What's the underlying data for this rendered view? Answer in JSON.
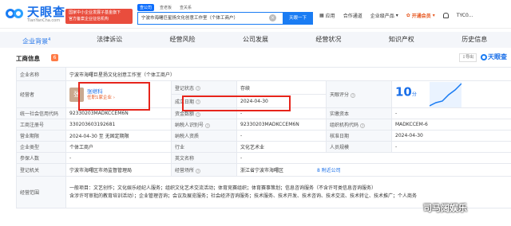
{
  "header": {
    "logo_text": "天眼查",
    "logo_url": "TianYanCha.com",
    "promo_line1": "国家中小企业发展子基金旗下",
    "promo_line2": "官方备案企业征信机构",
    "search_tabs": [
      "查公司",
      "查老板",
      "查关系"
    ],
    "search_value": "宁波市海曙巨星扬文化创意工作室（个体工商户）",
    "search_button": "天眼一下",
    "nav": {
      "app": "应用",
      "partner": "合作通道",
      "enterprise": "企业级产品",
      "vip": "开通会员",
      "user": "TYC0..."
    }
  },
  "tabs": [
    {
      "label": "企业背景",
      "sup": "4",
      "active": true
    },
    {
      "label": "法律诉讼",
      "sup": "",
      "active": false
    },
    {
      "label": "经营风险",
      "sup": "",
      "active": false
    },
    {
      "label": "公司发展",
      "sup": "",
      "active": false
    },
    {
      "label": "经营状况",
      "sup": "",
      "active": false
    },
    {
      "label": "知识产权",
      "sup": "",
      "active": false
    },
    {
      "label": "历史信息",
      "sup": "",
      "active": false
    }
  ],
  "section": {
    "title": "工商信息",
    "badge": "6",
    "export": "导出",
    "brand": "天眼查"
  },
  "company": {
    "name_label": "企业名称",
    "name": "宁波市海曙巨星扬文化创意工作室（个体工商户）",
    "operator_label": "经营者",
    "operator_avatar": "张",
    "operator_name": "张继科",
    "operator_sub": "任职1家企业 ›",
    "reg_status_label": "登记状态",
    "reg_status": "存续",
    "est_date_label": "成立日期",
    "est_date": "2024-04-30",
    "score_label": "天眼评分",
    "score": "10",
    "score_unit": "分",
    "credit_code_label": "统一社会信用代码",
    "credit_code": "92330203MADKCCEM6N",
    "capital_label": "资金数额",
    "capital": "-",
    "paid_capital_label": "实缴资本",
    "paid_capital": "-",
    "reg_no_label": "工商注册号",
    "reg_no": "330203603192681",
    "tax_id_label": "纳税人识别号",
    "tax_id": "92330203MADKCCEM6N",
    "org_code_label": "组织机构代码",
    "org_code": "MADKCCEM-6",
    "term_label": "营业期限",
    "term": "2024-04-30 至 无固定期限",
    "taxpayer_label": "纳税人资质",
    "taxpayer": "-",
    "approve_label": "核准日期",
    "approve": "2024-04-30",
    "type_label": "企业类型",
    "type": "个体工商户",
    "industry_label": "行业",
    "industry": "文化艺术业",
    "staff_label": "人员规模",
    "staff": "-",
    "insured_label": "参保人数",
    "insured": "-",
    "eng_name_label": "英文名称",
    "eng_name": "-",
    "authority_label": "登记机关",
    "authority": "宁波市海曙区市场监督管理局",
    "place_label": "经营场所",
    "place": "浙江省宁波市海曙区",
    "nearby": "8  附近公司",
    "scope_label": "经营范围",
    "scope_line1": "一般项目：文艺创作；文化娱乐经纪人服务；组织文化艺术交流活动；体育竞赛组织；体育赛事策划；信息咨询服务（不含许可类信息咨询服务）",
    "scope_line2": "含涉许可审批的教育培训活动）；企业管理咨询；会议及展览服务；社会经济咨询服务；技术服务、技术开发、技术咨询、技术交流、技术转让、技术推广；个人商务"
  },
  "watermark": "司马阔娱乐"
}
